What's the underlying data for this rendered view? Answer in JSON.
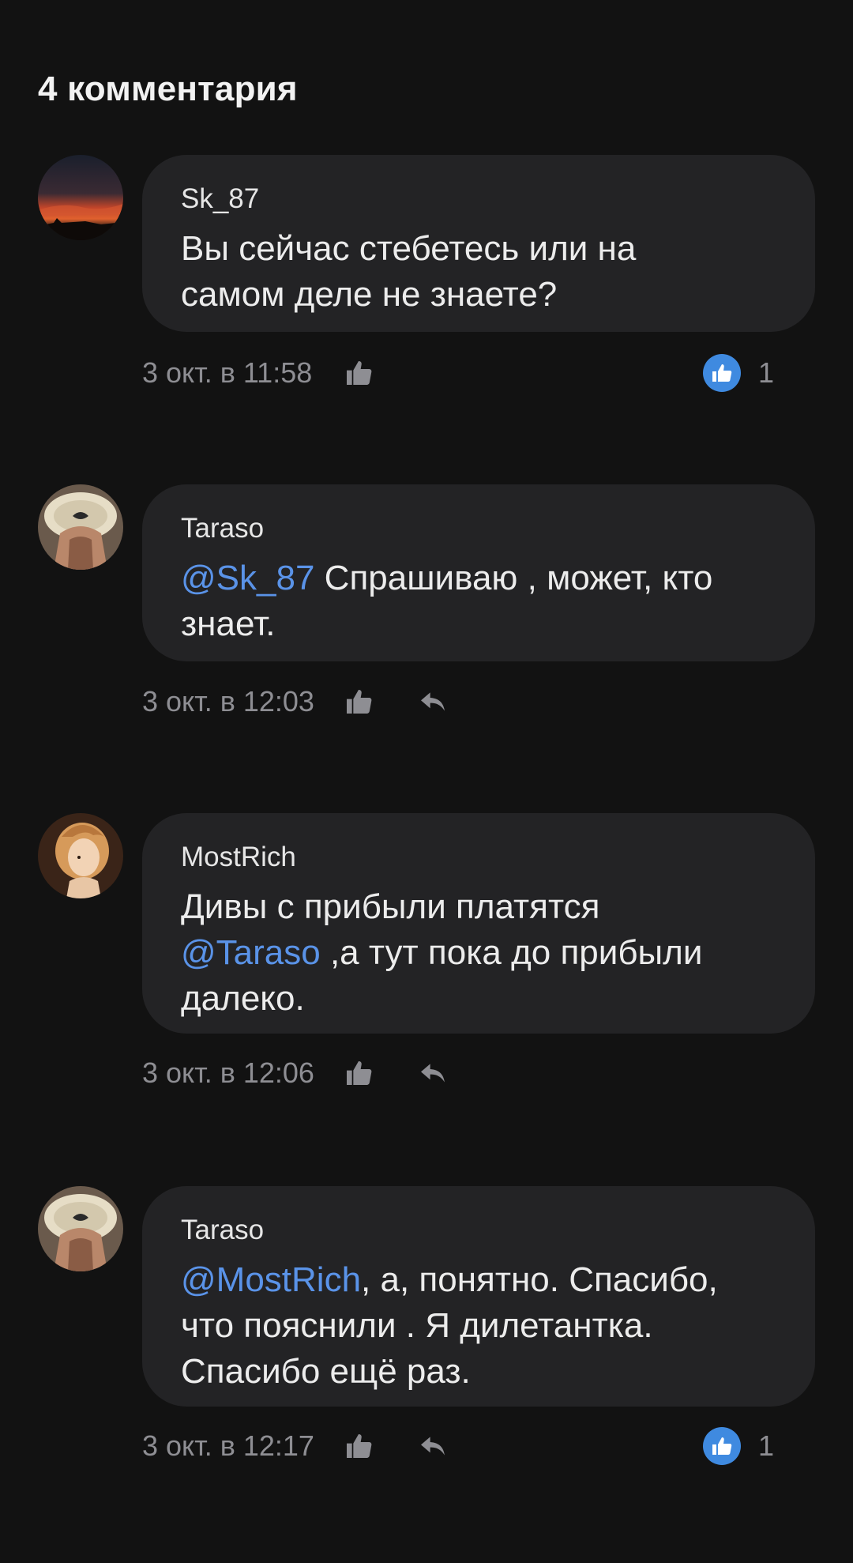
{
  "header": {
    "title": "4 комментария"
  },
  "colors": {
    "background": "#121212",
    "bubble": "#232325",
    "mention": "#5a93e8",
    "meta": "#8e8e93",
    "like_badge": "#3f8ae0"
  },
  "icons": {
    "like": "thumbs-up-icon",
    "reply": "reply-arrow-icon",
    "liked_badge": "thumbs-up-filled-icon"
  },
  "comments": [
    {
      "author": "Sk_87",
      "line1_pre": "Вы сейчас стебетесь или на",
      "line2": "самом деле не знаете?",
      "time": "3 окт. в 11:58",
      "likes": "1"
    },
    {
      "author": "Taraso",
      "mention": "@Sk_87",
      "line1_post": " Спрашиваю , может, кто",
      "line2": "знает.",
      "time": "3 окт. в 12:03"
    },
    {
      "author": "MostRich",
      "line1": "Дивы с прибыли платятся",
      "mention": "@Taraso",
      "line2_post": " ,а тут пока до прибыли",
      "line3": "далеко.",
      "time": "3 окт. в 12:06"
    },
    {
      "author": "Taraso",
      "mention": "@MostRich",
      "line1_post": ", а, понятно. Спасибо,",
      "line2": "что пояснили . Я дилетантка.",
      "line3": "Спасибо ещё раз.",
      "time": "3 окт. в 12:17",
      "likes": "1"
    }
  ]
}
